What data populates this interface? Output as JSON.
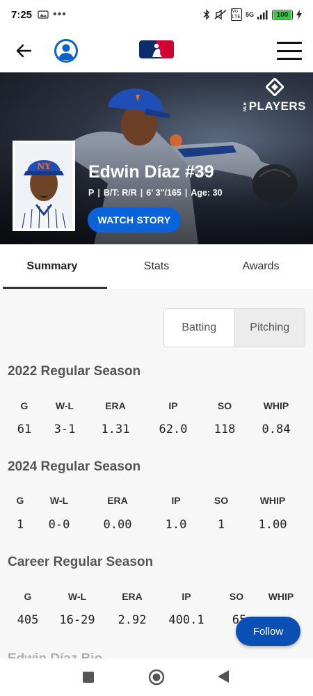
{
  "status_bar": {
    "time": "7:25",
    "network": "5G",
    "battery": "100",
    "battery_level": 1.0,
    "icons": [
      "photo-icon",
      "more-dots-icon",
      "bluetooth-icon",
      "mute-icon",
      "volte-icon",
      "signal-icon",
      "battery-icon",
      "charging-icon"
    ]
  },
  "header": {
    "icons": [
      "back-arrow-icon",
      "profile-icon",
      "mlb-logo",
      "hamburger-menu-icon"
    ]
  },
  "hero": {
    "players_logo_text": "PLAYERS",
    "players_logo_small": "MLB",
    "player_name": "Edwin Díaz #39",
    "meta": [
      "P",
      "B/T: R/R",
      "6' 3\"/165",
      "Age: 30"
    ],
    "watch_label": "WATCH STORY"
  },
  "tabs": [
    {
      "label": "Summary",
      "active": true
    },
    {
      "label": "Stats",
      "active": false
    },
    {
      "label": "Awards",
      "active": false
    }
  ],
  "toggle": {
    "options": [
      "Batting",
      "Pitching"
    ],
    "selected": "Pitching"
  },
  "sections": [
    {
      "title": "2022 Regular Season",
      "headers": [
        "G",
        "W-L",
        "ERA",
        "IP",
        "SO",
        "WHIP"
      ],
      "values": [
        "61",
        "3-1",
        "1.31",
        "62.0",
        "118",
        "0.84"
      ]
    },
    {
      "title": "2024 Regular Season",
      "headers": [
        "G",
        "W-L",
        "ERA",
        "IP",
        "SO",
        "WHIP"
      ],
      "values": [
        "1",
        "0-0",
        "0.00",
        "1.0",
        "1",
        "1.00"
      ]
    },
    {
      "title": "Career Regular Season",
      "headers": [
        "G",
        "W-L",
        "ERA",
        "IP",
        "SO",
        "WHIP"
      ],
      "values": [
        "405",
        "16-29",
        "2.92",
        "400.1",
        "65",
        ""
      ]
    }
  ],
  "bio_title": "Edwin Díaz Bio",
  "follow_label": "Follow",
  "colors": {
    "accent": "#0a63d9",
    "follow": "#0a4fb3",
    "mets_blue": "#0b3b8c",
    "mets_orange": "#f26b21"
  }
}
